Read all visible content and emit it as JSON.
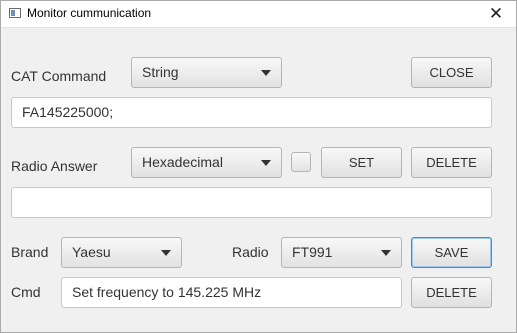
{
  "window": {
    "title": "Monitor cummunication",
    "close_glyph": "✕"
  },
  "cat": {
    "label": "CAT Command",
    "format_selected": "String",
    "close_label": "CLOSE",
    "command_value": "FA145225000;"
  },
  "answer": {
    "label": "Radio Answer",
    "format_selected": "Hexadecimal",
    "checkbox_checked": false,
    "set_label": "SET",
    "delete_label": "DELETE",
    "value": ""
  },
  "brand": {
    "label": "Brand",
    "selected": "Yaesu",
    "radio_label": "Radio",
    "radio_selected": "FT991",
    "save_label": "SAVE"
  },
  "cmd": {
    "label": "Cmd",
    "value": "Set frequency to 145.225 MHz",
    "delete_label": "DELETE"
  },
  "colors": {
    "focus": "#3c8ddc",
    "background": "#f0f0f0"
  }
}
